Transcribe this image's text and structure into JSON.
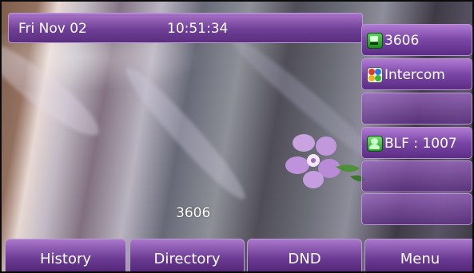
{
  "status_bar": {
    "date": "Fri Nov 02",
    "time": "10:51:34"
  },
  "line_keys": [
    {
      "label": "3606",
      "icon": "line-account-icon"
    },
    {
      "label": "Intercom",
      "icon": "intercom-icon"
    },
    {
      "label": "",
      "icon": ""
    },
    {
      "label": "BLF : 1007",
      "icon": "blf-contact-icon"
    },
    {
      "label": "",
      "icon": ""
    },
    {
      "label": "",
      "icon": ""
    }
  ],
  "account_label": "3606",
  "soft_keys": [
    "History",
    "Directory",
    "DND",
    "Menu"
  ],
  "colors": {
    "accent_purple": "#7a46a6",
    "text": "#ffffff",
    "blf_green": "#2a9a2a"
  }
}
